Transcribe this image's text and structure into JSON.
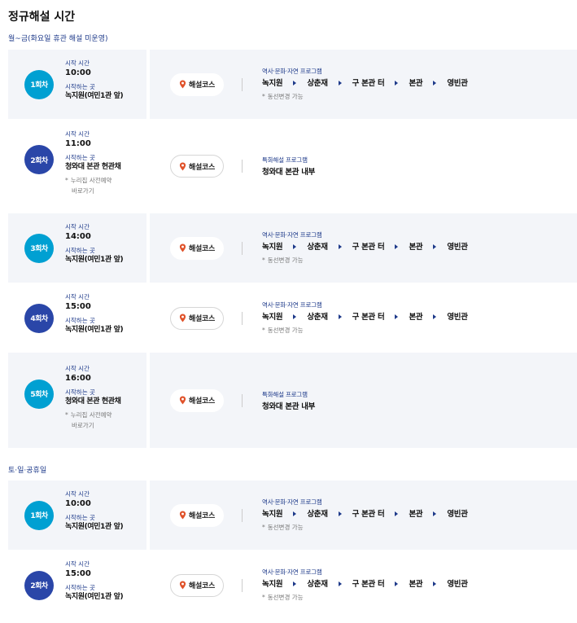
{
  "page_title": "정규해설 시간",
  "labels": {
    "start_time": "시작 시간",
    "start_place": "시작하는 곳",
    "course_button": "해설코스"
  },
  "groups": [
    {
      "day_label": "월~금(화요일 휴관 해설 미운영)",
      "sessions": [
        {
          "badge": "1회차",
          "time": "10:00",
          "place": "녹지원(여민1관 앞)",
          "program_label": "역사·문화·자연 프로그램",
          "route": [
            "녹지원",
            "상춘재",
            "구 본관 터",
            "본관",
            "영빈관"
          ],
          "note": "동선변경 가능"
        },
        {
          "badge": "2회차",
          "time": "11:00",
          "place": "청와대 본관 현관채",
          "reserve_text": "누리집 사전예약",
          "reserve_link": "바로가기",
          "program_label": "특화해설 프로그램",
          "program_text": "청와대 본관 내부"
        },
        {
          "badge": "3회차",
          "time": "14:00",
          "place": "녹지원(여민1관 앞)",
          "program_label": "역사·문화·자연 프로그램",
          "route": [
            "녹지원",
            "상춘재",
            "구 본관 터",
            "본관",
            "영빈관"
          ],
          "note": "동선변경 가능"
        },
        {
          "badge": "4회차",
          "time": "15:00",
          "place": "녹지원(여민1관 앞)",
          "program_label": "역사·문화·자연 프로그램",
          "route": [
            "녹지원",
            "상춘재",
            "구 본관 터",
            "본관",
            "영빈관"
          ],
          "note": "동선변경 가능"
        },
        {
          "badge": "5회차",
          "time": "16:00",
          "place": "청와대 본관 현관채",
          "reserve_text": "누리집 사전예약",
          "reserve_link": "바로가기",
          "program_label": "특화해설 프로그램",
          "program_text": "청와대 본관 내부"
        }
      ]
    },
    {
      "day_label": "토·일·공휴일",
      "sessions": [
        {
          "badge": "1회차",
          "time": "10:00",
          "place": "녹지원(여민1관 앞)",
          "program_label": "역사·문화·자연 프로그램",
          "route": [
            "녹지원",
            "상춘재",
            "구 본관 터",
            "본관",
            "영빈관"
          ],
          "note": "동선변경 가능"
        },
        {
          "badge": "2회차",
          "time": "15:00",
          "place": "녹지원(여민1관 앞)",
          "program_label": "역사·문화·자연 프로그램",
          "route": [
            "녹지원",
            "상춘재",
            "구 본관 터",
            "본관",
            "영빈관"
          ],
          "note": "동선변경 가능"
        }
      ]
    }
  ],
  "colors": {
    "badge_primary": "#00a0d2",
    "badge_secondary": "#2a46a8",
    "accent": "#1e3a8a",
    "row_shade": "#f3f5f9"
  },
  "icons": {
    "course": "location-pin-icon",
    "route_separator": "triangle-right-icon",
    "note": "asterisk-icon"
  }
}
